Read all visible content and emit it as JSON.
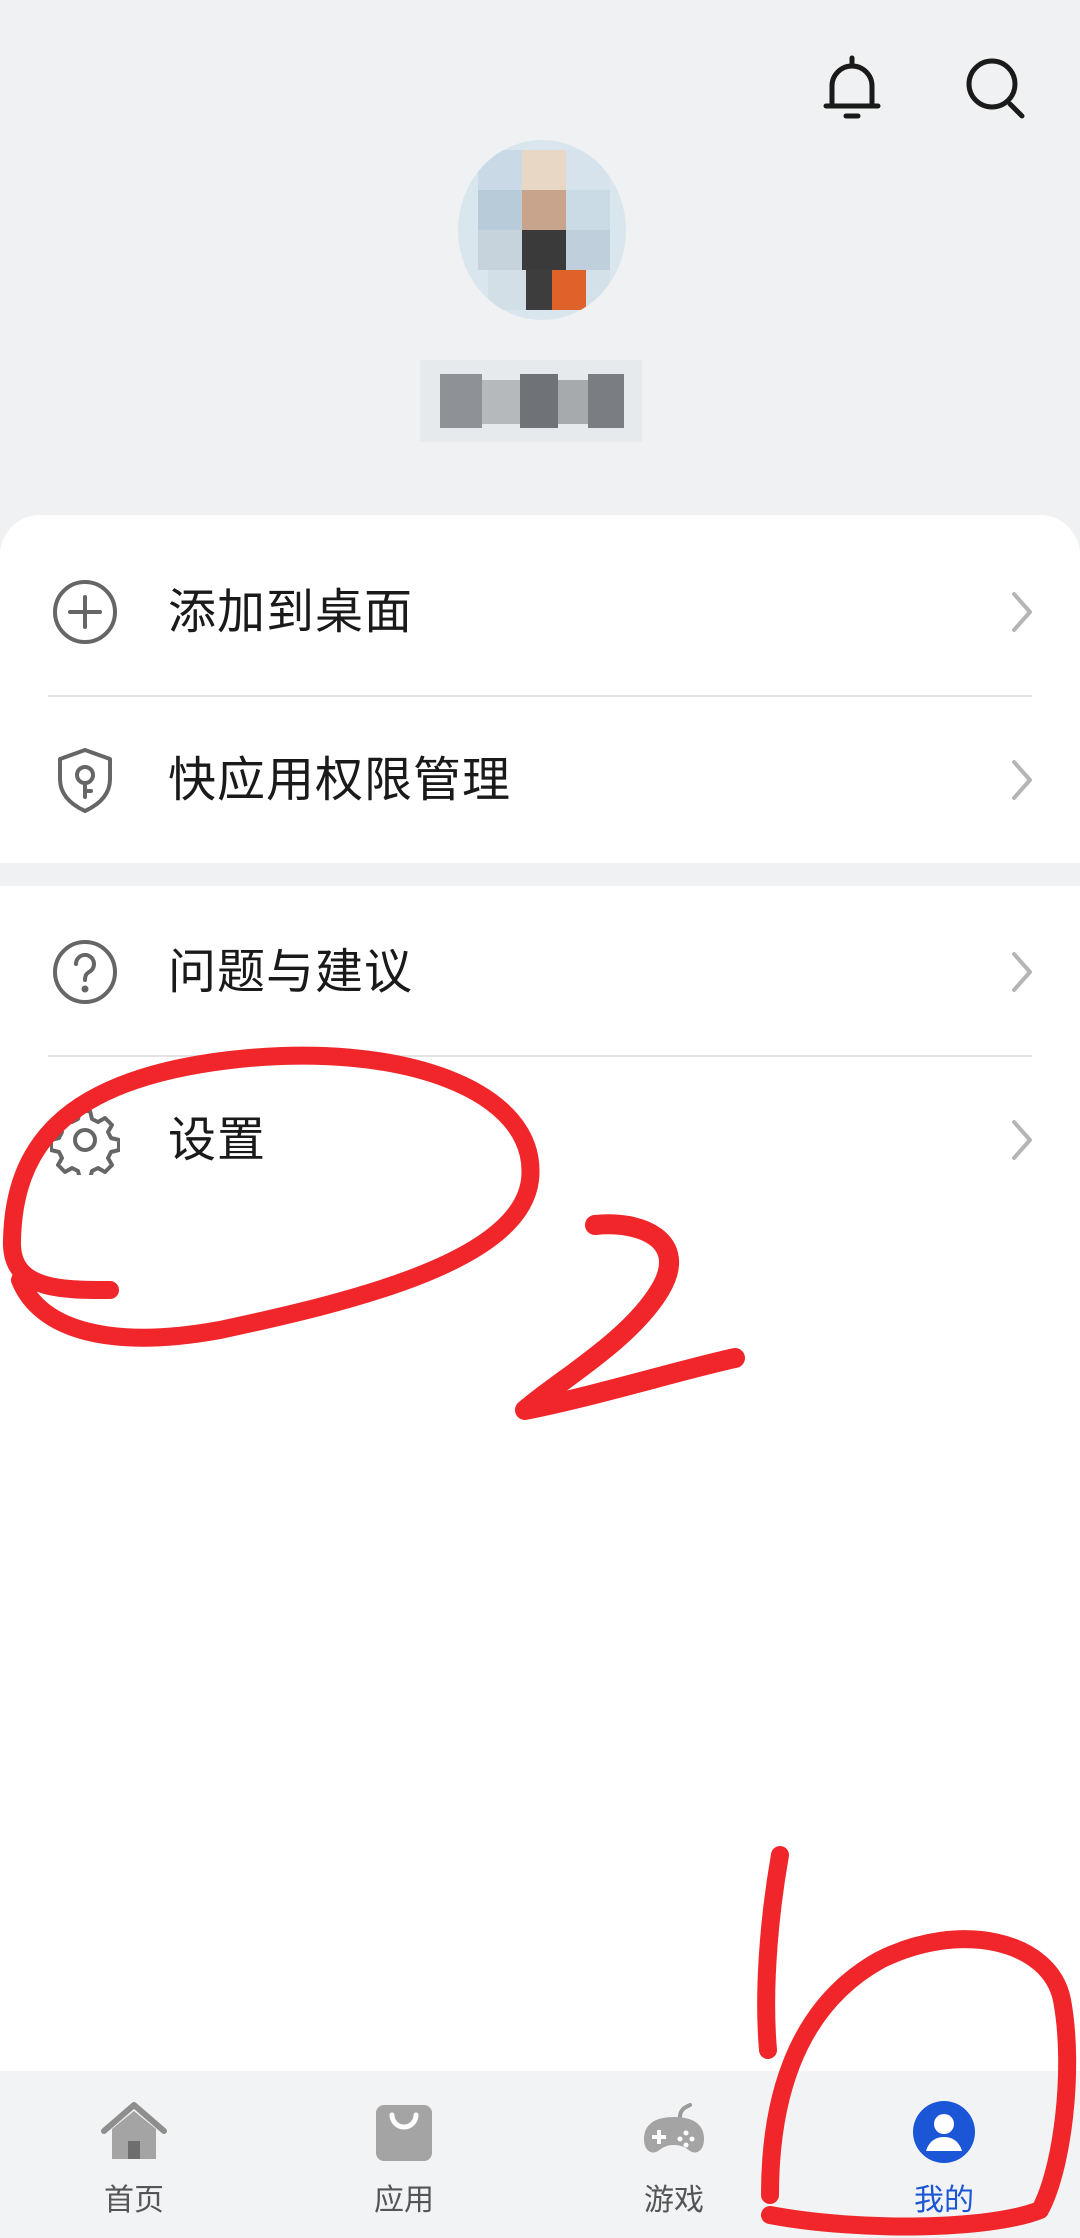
{
  "header": {
    "icons": [
      "bell-icon",
      "search-icon"
    ]
  },
  "profile": {
    "avatar_blurred": true,
    "username_blurred": true
  },
  "menu": {
    "group1": [
      {
        "label": "添加到桌面",
        "icon": "add-circle-icon"
      },
      {
        "label": "快应用权限管理",
        "icon": "shield-key-icon"
      }
    ],
    "group2": [
      {
        "label": "问题与建议",
        "icon": "help-circle-icon"
      },
      {
        "label": "设置",
        "icon": "gear-icon"
      }
    ]
  },
  "tabbar": {
    "tabs": [
      {
        "label": "首页",
        "icon": "home-icon"
      },
      {
        "label": "应用",
        "icon": "bag-icon"
      },
      {
        "label": "游戏",
        "icon": "gamepad-icon"
      },
      {
        "label": "我的",
        "icon": "user-icon",
        "active": true
      }
    ]
  },
  "annotations": {
    "marks": [
      "1",
      "2"
    ],
    "color": "#f0262a"
  },
  "colors": {
    "accent": "#1a56d6",
    "background": "#eff1f2",
    "annotation_red": "#f0262a"
  }
}
